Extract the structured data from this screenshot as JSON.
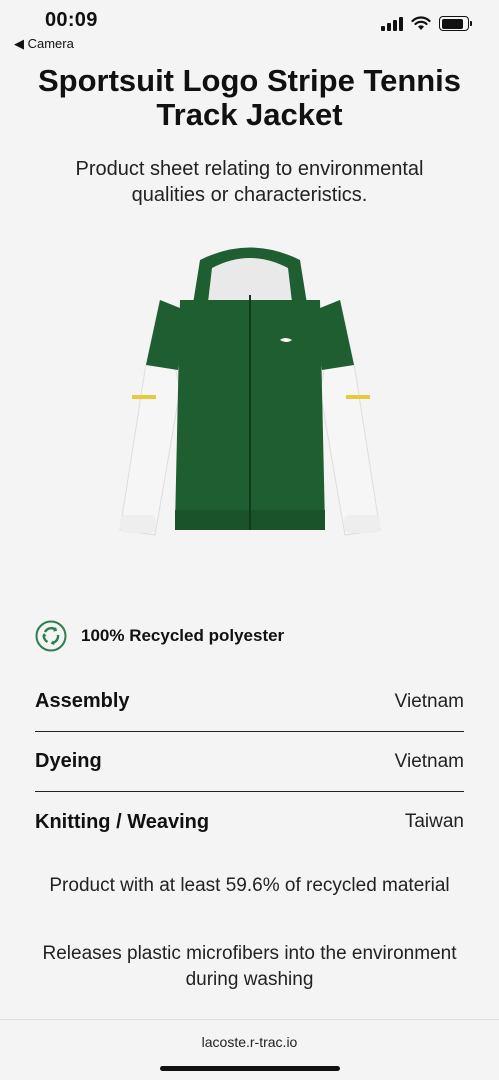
{
  "status": {
    "time": "00:09",
    "back_label": "◀ Camera"
  },
  "product": {
    "title": "Sportsuit Logo Stripe Tennis Track Jacket",
    "subtitle": "Product sheet relating to environmental qualities or characteristics.",
    "image_icon": "green-white-track-jacket",
    "colors": {
      "green": "#1e5e31",
      "white": "#f6f6f6"
    }
  },
  "material": {
    "icon": "recycle-icon",
    "label": "100% Recycled polyester",
    "color": "#2e7d4f"
  },
  "origins": [
    {
      "step": "Assembly",
      "country": "Vietnam"
    },
    {
      "step": "Dyeing",
      "country": "Vietnam"
    },
    {
      "step": "Knitting / Weaving",
      "country": "Taiwan"
    }
  ],
  "notes": {
    "recycled": "Product with at least 59.6% of recycled material",
    "microfibers": "Releases plastic microfibers into the environment during washing"
  },
  "browser": {
    "url": "lacoste.r-trac.io"
  }
}
